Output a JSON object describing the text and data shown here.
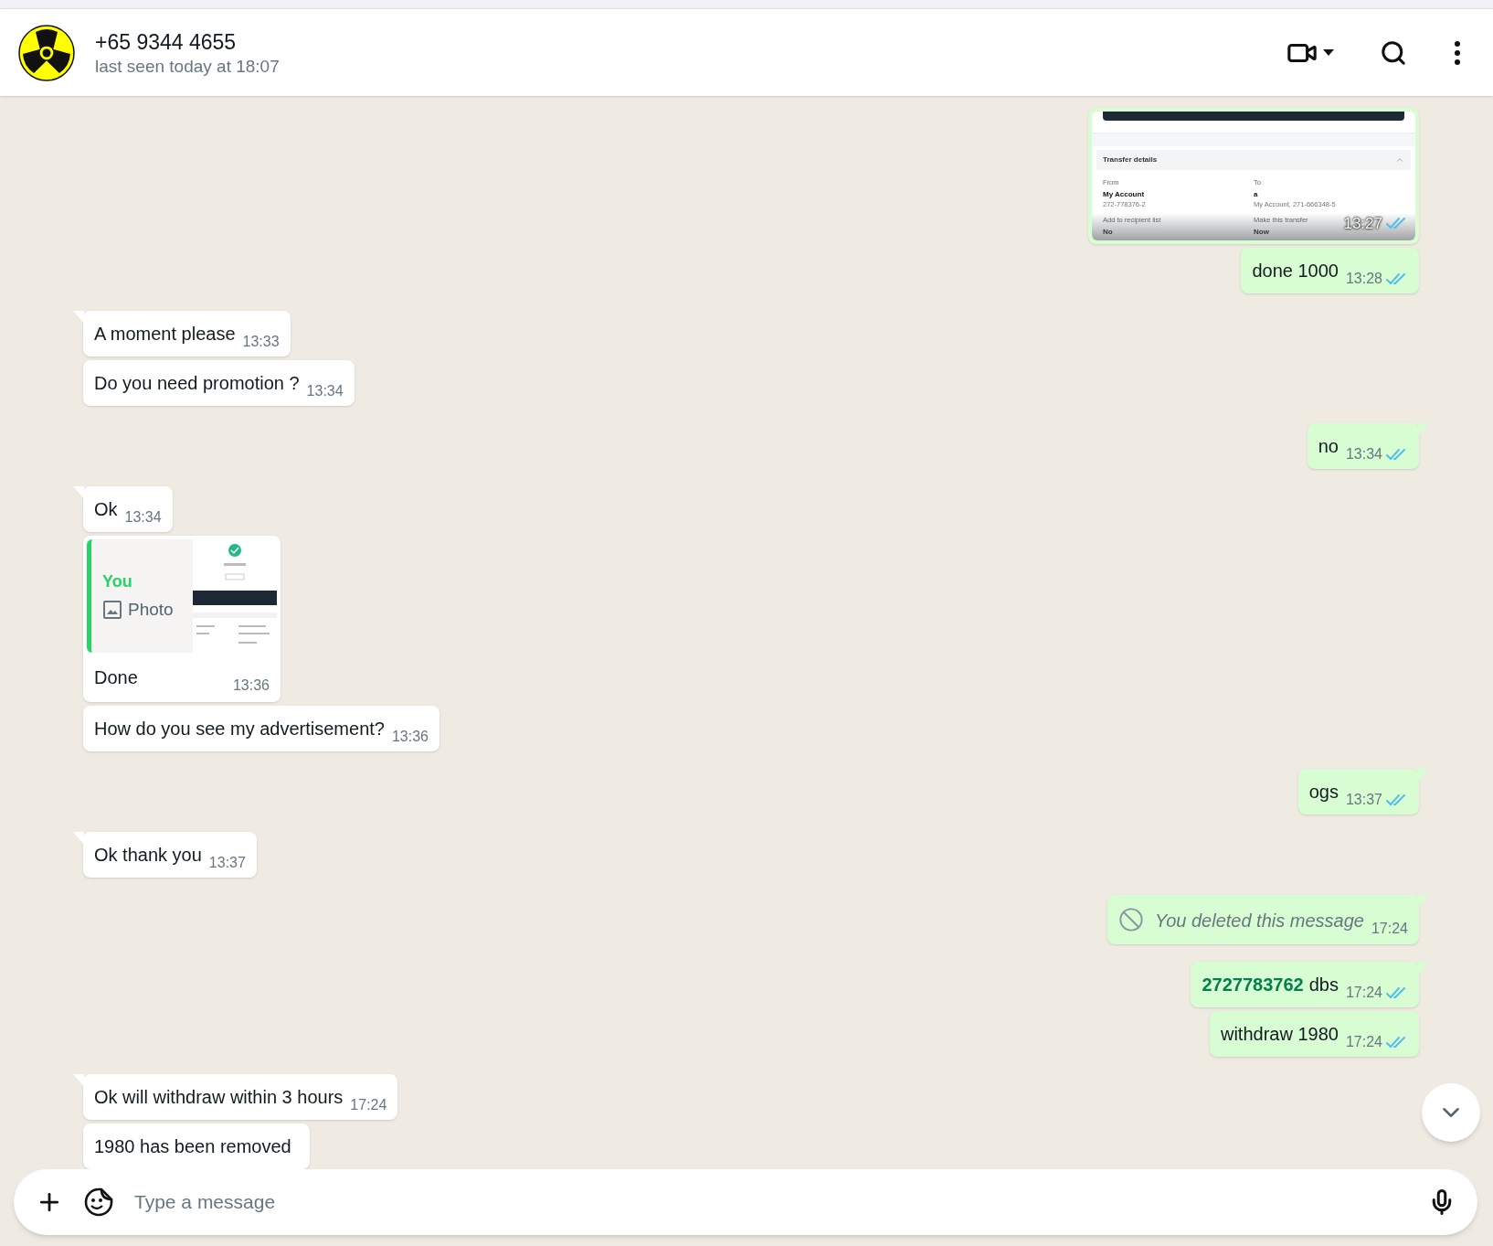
{
  "header": {
    "name": "+65 9344 4655",
    "status": "last seen today at 18:07"
  },
  "messages": [
    {
      "kind": "image",
      "outgoing": true,
      "tail": false,
      "time": "13:27",
      "read": true,
      "image": {
        "section": "Transfer details",
        "fields": [
          {
            "label": "From",
            "value": "My Account",
            "detail": "272-778376-2"
          },
          {
            "label": "To",
            "value": "a",
            "detail": "My Account, 271-666348-5"
          },
          {
            "label": "Add to recipient list",
            "value": "No"
          },
          {
            "label": "Make this transfer",
            "value": "Now"
          }
        ]
      }
    },
    {
      "kind": "text",
      "outgoing": true,
      "tail": false,
      "text": "done 1000",
      "time": "13:28",
      "read": true
    },
    {
      "kind": "text",
      "outgoing": false,
      "tail": true,
      "text": "A moment please",
      "time": "13:33"
    },
    {
      "kind": "text",
      "outgoing": false,
      "tail": false,
      "text": "Do you need promotion ?",
      "time": "13:34"
    },
    {
      "kind": "text",
      "outgoing": true,
      "tail": true,
      "text": "no",
      "time": "13:34",
      "read": true
    },
    {
      "kind": "text",
      "outgoing": false,
      "tail": true,
      "text": "Ok",
      "time": "13:34"
    },
    {
      "kind": "reply",
      "outgoing": false,
      "tail": false,
      "quote": {
        "author": "You",
        "label": "Photo"
      },
      "text": "Done",
      "time": "13:36"
    },
    {
      "kind": "text",
      "outgoing": false,
      "tail": false,
      "text": "How do you see my advertisement?",
      "time": "13:36"
    },
    {
      "kind": "text",
      "outgoing": true,
      "tail": true,
      "text": "ogs",
      "time": "13:37",
      "read": true
    },
    {
      "kind": "text",
      "outgoing": false,
      "tail": true,
      "text": "Ok thank you",
      "time": "13:37"
    },
    {
      "kind": "deleted",
      "outgoing": true,
      "tail": true,
      "text": "You deleted this message",
      "time": "17:24"
    },
    {
      "kind": "link_text",
      "outgoing": true,
      "tail": true,
      "link": "2727783762",
      "text": "dbs",
      "time": "17:24",
      "read": true
    },
    {
      "kind": "text",
      "outgoing": true,
      "tail": false,
      "text": "withdraw 1980",
      "time": "17:24",
      "read": true
    },
    {
      "kind": "text",
      "outgoing": false,
      "tail": true,
      "text": "Ok will withdraw within 3 hours",
      "time": "17:24"
    },
    {
      "kind": "text",
      "outgoing": false,
      "tail": false,
      "text": "1980 has been removed"
    }
  ],
  "composer": {
    "placeholder": "Type a message"
  }
}
